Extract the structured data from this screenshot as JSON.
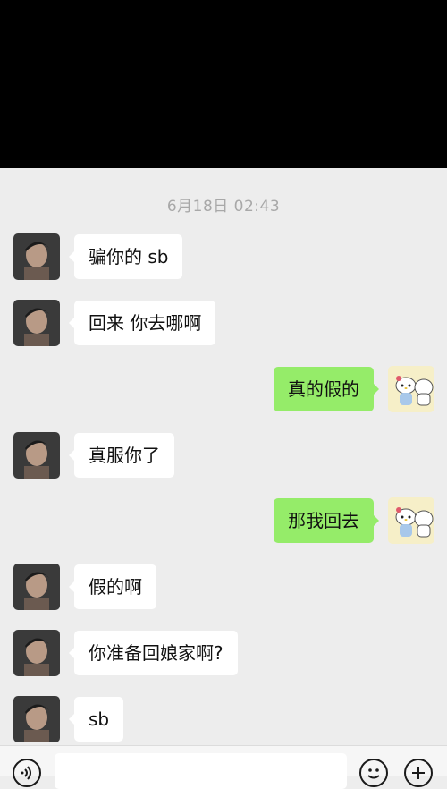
{
  "timestamp": "6月18日 02:43",
  "messages": [
    {
      "side": "left",
      "text": "骗你的 sb"
    },
    {
      "side": "left",
      "text": "回来 你去哪啊"
    },
    {
      "side": "right",
      "text": "真的假的"
    },
    {
      "side": "left",
      "text": "真服你了"
    },
    {
      "side": "right",
      "text": "那我回去"
    },
    {
      "side": "left",
      "text": "假的啊"
    },
    {
      "side": "left",
      "text": "你准备回娘家啊?"
    },
    {
      "side": "left",
      "text": "sb"
    }
  ],
  "input_bar": {
    "icons": [
      "voice-icon",
      "emoji-icon",
      "plus-icon"
    ]
  },
  "colors": {
    "background": "#ededed",
    "sent_bubble": "#95ec69",
    "received_bubble": "#ffffff",
    "timestamp_text": "#a8a8a8"
  }
}
